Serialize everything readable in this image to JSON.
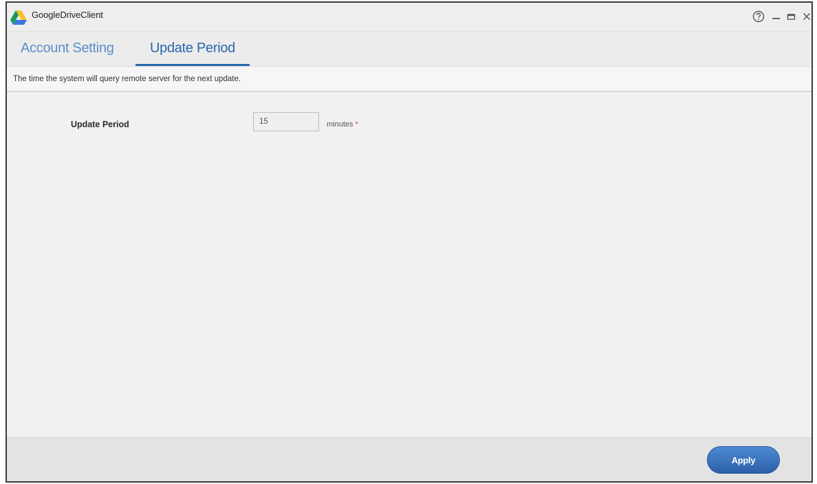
{
  "window": {
    "title": "GoogleDriveClient",
    "controls": {
      "help_icon": "help-circle-icon",
      "minimize_icon": "minimize-icon",
      "maximize_icon": "maximize-icon",
      "close_icon": "close-icon"
    }
  },
  "tabs": [
    {
      "label": "Account Setting",
      "active": false
    },
    {
      "label": "Update Period",
      "active": true
    }
  ],
  "description": "The time the system will query remote server for the next update.",
  "form": {
    "update_period": {
      "label": "Update Period",
      "value": "15",
      "unit": "minutes",
      "required_marker": "*"
    }
  },
  "footer": {
    "apply_label": "Apply"
  },
  "colors": {
    "accent": "#2a66b0",
    "inactive_tab": "#5a8ec9",
    "required": "#d9342b",
    "apply_button": "#3a73c0"
  }
}
